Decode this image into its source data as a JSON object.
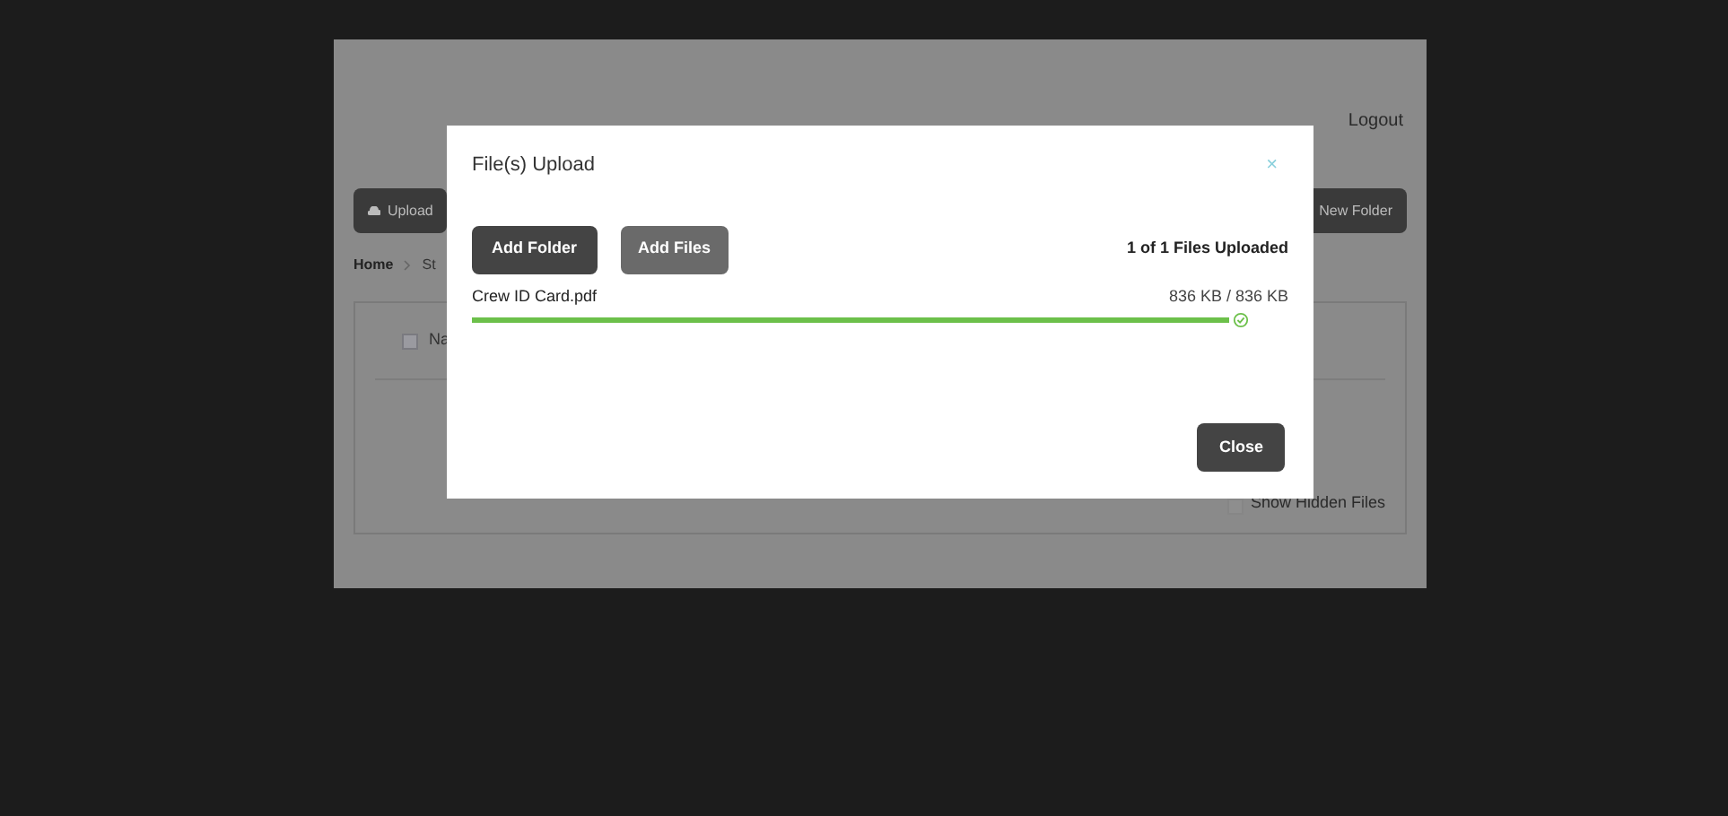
{
  "page": {
    "logout": "Logout",
    "upload_button": "Upload",
    "new_folder_button": "New Folder",
    "breadcrumb": [
      "Home",
      "St"
    ],
    "table": {
      "select_all_checked": false,
      "column_1": "Na"
    },
    "show_hidden_files": {
      "label": "Show Hidden Files",
      "checked": false
    }
  },
  "dialog": {
    "title": "File(s) Upload",
    "close_icon": "×",
    "buttons": [
      "Add Folder",
      "Add Files"
    ],
    "status": "1 of 1 Files Uploaded",
    "files": [
      {
        "name": "Crew ID Card.pdf",
        "size": "836 KB / 836 KB",
        "level": 1,
        "done": true
      }
    ],
    "close_button": "Close"
  }
}
